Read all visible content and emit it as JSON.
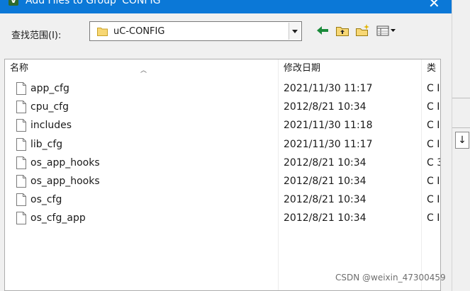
{
  "window": {
    "title": "Add Files to Group 'CONFIG'",
    "app_icon_letter": "V",
    "close_glyph": "✕"
  },
  "lookin": {
    "label": "查找范围(I):",
    "current_folder": "uC-CONFIG"
  },
  "toolbar": {
    "back_icon": "back-arrow-icon",
    "up_icon": "up-folder-icon",
    "new_folder_icon": "new-folder-icon",
    "view_menu_icon": "view-menu-icon"
  },
  "columns": {
    "name": "名称",
    "modified": "修改日期",
    "type": "类"
  },
  "files": [
    {
      "name": "app_cfg",
      "modified": "2021/11/30 11:17",
      "type": "C I"
    },
    {
      "name": "cpu_cfg",
      "modified": "2012/8/21 10:34",
      "type": "C I"
    },
    {
      "name": "includes",
      "modified": "2021/11/30 11:18",
      "type": "C I"
    },
    {
      "name": "lib_cfg",
      "modified": "2021/11/30 11:17",
      "type": "C I"
    },
    {
      "name": "os_app_hooks",
      "modified": "2012/8/21 10:34",
      "type": "C 3"
    },
    {
      "name": "os_app_hooks",
      "modified": "2012/8/21 10:34",
      "type": "C I"
    },
    {
      "name": "os_cfg",
      "modified": "2012/8/21 10:34",
      "type": "C I"
    },
    {
      "name": "os_cfg_app",
      "modified": "2012/8/21 10:34",
      "type": "C I"
    }
  ],
  "background_window": {
    "button_glyph": "↓"
  },
  "watermark": "CSDN @weixin_47300459",
  "colors": {
    "titlebar": "#0b78d7",
    "dialog_bg": "#f0f0f0",
    "folder_yellow": "#f7d774",
    "back_arrow": "#1a8a3a"
  }
}
